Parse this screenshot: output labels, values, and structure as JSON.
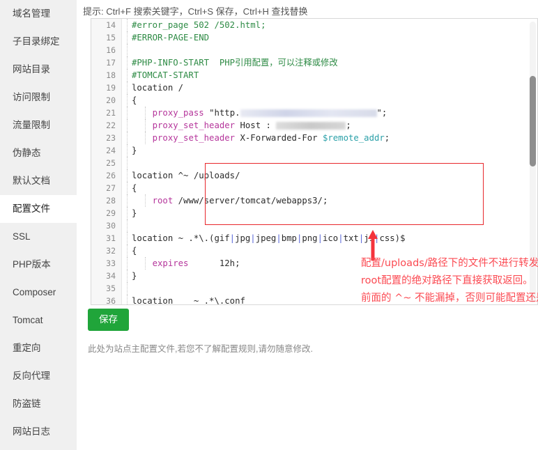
{
  "sidebar": {
    "items": [
      {
        "label": "域名管理",
        "active": false
      },
      {
        "label": "子目录绑定",
        "active": false
      },
      {
        "label": "网站目录",
        "active": false
      },
      {
        "label": "访问限制",
        "active": false
      },
      {
        "label": "流量限制",
        "active": false
      },
      {
        "label": "伪静态",
        "active": false
      },
      {
        "label": "默认文档",
        "active": false
      },
      {
        "label": "配置文件",
        "active": true
      },
      {
        "label": "SSL",
        "active": false
      },
      {
        "label": "PHP版本",
        "active": false
      },
      {
        "label": "Composer",
        "active": false
      },
      {
        "label": "Tomcat",
        "active": false
      },
      {
        "label": "重定向",
        "active": false
      },
      {
        "label": "反向代理",
        "active": false
      },
      {
        "label": "防盗链",
        "active": false
      },
      {
        "label": "网站日志",
        "active": false
      }
    ]
  },
  "hint": "提示: Ctrl+F 搜索关键字，Ctrl+S 保存，Ctrl+H 查找替换",
  "editor": {
    "first_line_number": 14,
    "lines": [
      {
        "n": 14,
        "text": "#error_page 502 /502.html;"
      },
      {
        "n": 15,
        "text": "#ERROR-PAGE-END"
      },
      {
        "n": 16,
        "text": ""
      },
      {
        "n": 17,
        "text": "#PHP-INFO-START  PHP引用配置，可以注释或修改"
      },
      {
        "n": 18,
        "text": "#TOMCAT-START"
      },
      {
        "n": 19,
        "text": "location /"
      },
      {
        "n": 20,
        "text": "{"
      },
      {
        "n": 21,
        "text": "    proxy_pass \"http.            \";"
      },
      {
        "n": 22,
        "text": "    proxy_set_header Host :        ;"
      },
      {
        "n": 23,
        "text": "    proxy_set_header X-Forwarded-For $remote_addr;"
      },
      {
        "n": 24,
        "text": "}"
      },
      {
        "n": 25,
        "text": ""
      },
      {
        "n": 26,
        "text": "location ^~ /uploads/"
      },
      {
        "n": 27,
        "text": "{"
      },
      {
        "n": 28,
        "text": "    root /www/server/tomcat/webapps3/;"
      },
      {
        "n": 29,
        "text": "}"
      },
      {
        "n": 30,
        "text": ""
      },
      {
        "n": 31,
        "text": "location ~ .*\\.(gif|jpg|jpeg|bmp|png|ico|txt|js|css)$"
      },
      {
        "n": 32,
        "text": "{"
      },
      {
        "n": 33,
        "text": "    expires      12h;"
      },
      {
        "n": 34,
        "text": "}"
      },
      {
        "n": 35,
        "text": ""
      },
      {
        "n": 36,
        "text": "location    ~ .*\\.conf"
      }
    ]
  },
  "annotation": {
    "line1": "配置/uploads/路径下的文件不进行转发，直接在",
    "line2": "root配置的绝对路径下直接获取返回。",
    "line3": "前面的 ^~ 不能漏掉，否则可能配置还是无法访问"
  },
  "save_button": {
    "label": "保存"
  },
  "footer": {
    "text": "此处为站点主配置文件,若您不了解配置规则,请勿随意修改."
  },
  "colors": {
    "accent_green": "#20a53a",
    "annotation_red": "#fb4a52",
    "box_red": "#e8262b",
    "comment_green": "#2e8b45",
    "keyword_magenta": "#b5359b",
    "variable_teal": "#2aa0a8",
    "sidebar_bg": "#f0f0f0"
  }
}
